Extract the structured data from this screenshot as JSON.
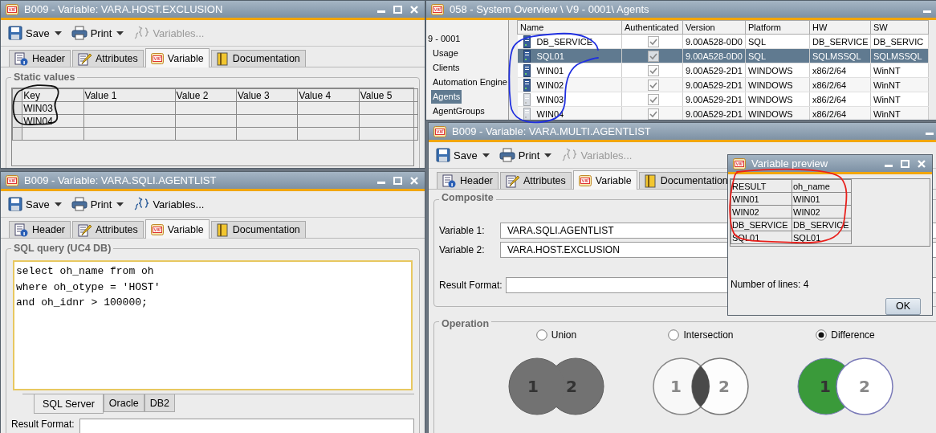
{
  "host_exclusion": {
    "title": "B009 - Variable: VARA.HOST.EXCLUSION",
    "toolbar": [
      {
        "label": "Save",
        "kind": "menu",
        "disabled": false
      },
      {
        "label": "Print",
        "kind": "menu",
        "disabled": false
      },
      {
        "label": "Variables...",
        "kind": "plain",
        "disabled": true
      }
    ],
    "tabs": [
      {
        "label": "Header",
        "selected": false
      },
      {
        "label": "Attributes",
        "selected": false
      },
      {
        "label": "Variable",
        "selected": true
      },
      {
        "label": "Documentation",
        "selected": false
      }
    ],
    "static_values": {
      "legend": "Static values",
      "columns": [
        "Key",
        "Value 1",
        "Value 2",
        "Value 3",
        "Value 4",
        "Value 5"
      ],
      "rows": [
        {
          "key": "WIN03"
        },
        {
          "key": "WIN04"
        }
      ]
    }
  },
  "agents": {
    "title": "058 - System Overview \\ V9 - 0001\\ Agents",
    "tree": [
      {
        "label": "9 - 0001",
        "selected": false,
        "children": [
          {
            "label": "Usage",
            "selected": false
          },
          {
            "label": "Clients",
            "selected": false
          },
          {
            "label": "Automation Engine",
            "selected": false
          },
          {
            "label": "Agents",
            "selected": true
          },
          {
            "label": "AgentGroups",
            "selected": false
          }
        ]
      }
    ],
    "columns": [
      "Name",
      "Authenticated",
      "Version",
      "Platform",
      "HW",
      "SW"
    ],
    "rows": [
      {
        "name": "DB_SERVICE",
        "authenticated": true,
        "version": "9.00A528-0D0",
        "platform": "SQL",
        "hw": "DB_SERVICE",
        "sw": "DB_SERVIC",
        "selected": false,
        "active": true
      },
      {
        "name": "SQL01",
        "authenticated": true,
        "version": "9.00A528-0D0",
        "platform": "SQL",
        "hw": "SQLMSSQL",
        "sw": "SQLMSSQL",
        "selected": true,
        "active": true
      },
      {
        "name": "WIN01",
        "authenticated": true,
        "version": "9.00A529-2D1",
        "platform": "WINDOWS",
        "hw": "x86/2/64",
        "sw": "WinNT",
        "selected": false,
        "active": true
      },
      {
        "name": "WIN02",
        "authenticated": true,
        "version": "9.00A529-2D1",
        "platform": "WINDOWS",
        "hw": "x86/2/64",
        "sw": "WinNT",
        "selected": false,
        "active": true
      },
      {
        "name": "WIN03",
        "authenticated": true,
        "version": "9.00A529-2D1",
        "platform": "WINDOWS",
        "hw": "x86/2/64",
        "sw": "WinNT",
        "selected": false,
        "active": false
      },
      {
        "name": "WIN04",
        "authenticated": true,
        "version": "9.00A529-2D1",
        "platform": "WINDOWS",
        "hw": "x86/2/64",
        "sw": "WinNT",
        "selected": false,
        "active": false
      }
    ]
  },
  "sqli": {
    "title": "B009 - Variable: VARA.SQLI.AGENTLIST",
    "toolbar": [
      {
        "label": "Save",
        "kind": "menu",
        "disabled": false
      },
      {
        "label": "Print",
        "kind": "menu",
        "disabled": false
      },
      {
        "label": "Variables...",
        "kind": "plain",
        "disabled": false
      }
    ],
    "tabs": [
      {
        "label": "Header",
        "selected": false
      },
      {
        "label": "Attributes",
        "selected": false
      },
      {
        "label": "Variable",
        "selected": true
      },
      {
        "label": "Documentation",
        "selected": false
      }
    ],
    "sql": {
      "legend": "SQL query (UC4 DB)",
      "value": "select oh_name from oh\nwhere oh_otype = 'HOST'\nand oh_idnr > 100000;"
    },
    "dialect_tabs": [
      {
        "label": "SQL Server",
        "selected": true
      },
      {
        "label": "Oracle",
        "selected": false
      },
      {
        "label": "DB2",
        "selected": false
      }
    ],
    "result_format_label": "Result Format:"
  },
  "multi": {
    "title": "B009 - Variable: VARA.MULTI.AGENTLIST",
    "toolbar": [
      {
        "label": "Save",
        "kind": "menu",
        "disabled": false
      },
      {
        "label": "Print",
        "kind": "menu",
        "disabled": false
      },
      {
        "label": "Variables...",
        "kind": "plain",
        "disabled": true
      }
    ],
    "tabs": [
      {
        "label": "Header",
        "selected": false
      },
      {
        "label": "Attributes",
        "selected": false
      },
      {
        "label": "Variable",
        "selected": true
      },
      {
        "label": "Documentation",
        "selected": false
      }
    ],
    "composite": {
      "legend": "Composite",
      "fields": [
        {
          "label": "Variable 1:",
          "value": "VARA.SQLI.AGENTLIST"
        },
        {
          "label": "Variable 2:",
          "value": "VARA.HOST.EXCLUSION"
        },
        {
          "label": "Result Format:"
        }
      ]
    },
    "operation": {
      "legend": "Operation",
      "options": [
        {
          "label": "Union",
          "selected": false,
          "venn_labels": [
            "1",
            "2"
          ]
        },
        {
          "label": "Intersection",
          "selected": false,
          "venn_labels": [
            "1",
            "2"
          ]
        },
        {
          "label": "Difference",
          "selected": true,
          "venn_labels": [
            "1",
            "2"
          ]
        }
      ]
    }
  },
  "preview": {
    "title": "Variable preview",
    "columns": [
      "RESULT",
      "oh_name"
    ],
    "rows": [
      [
        "WIN01",
        "WIN01"
      ],
      [
        "WIN02",
        "WIN02"
      ],
      [
        "DB_SERVICE",
        "DB_SERVICE"
      ],
      [
        "SQL01",
        "SQL01"
      ]
    ],
    "line_count": "Number of lines: 4",
    "button": "OK"
  },
  "annotations": [
    {
      "color": "#111111"
    },
    {
      "color": "#1f2fe0"
    },
    {
      "color": "#e8201c"
    }
  ]
}
